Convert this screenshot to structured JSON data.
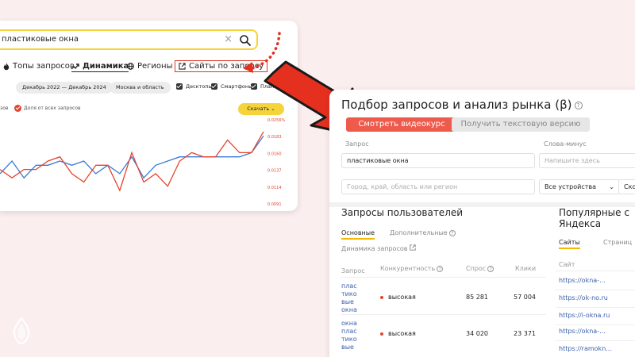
{
  "left": {
    "search_value": "пластиковые окна",
    "tabs": [
      {
        "label": "Топы запросов"
      },
      {
        "label": "Динамика"
      },
      {
        "label": "Регионы"
      },
      {
        "label": "Сайты по запросу"
      }
    ],
    "filters": {
      "period": "Декабрь 2022 — Декабрь 2024",
      "region": "Москва и область",
      "desktop": "Десктопы",
      "smartphones": "Смартфоны",
      "tablets": "Планш"
    },
    "legend": {
      "blue": "зов",
      "red": "Доля от всех запросов"
    },
    "download": "Скачать",
    "y_ticks": [
      "0.0256%",
      "0.0183",
      "0.0160",
      "0.0137",
      "0.0114",
      "0.0091"
    ]
  },
  "chart_data": {
    "type": "line",
    "ylabels_right": [
      "0.0256%",
      "0.0183",
      "0.0160",
      "0.0137",
      "0.0114",
      "0.0091"
    ],
    "series": [
      {
        "color": "#3a7bd5",
        "values": [
          0.35,
          0.5,
          0.3,
          0.45,
          0.45,
          0.5,
          0.45,
          0.5,
          0.35,
          0.45,
          0.35,
          0.55,
          0.3,
          0.45,
          0.5,
          0.55,
          0.55,
          0.55,
          0.55,
          0.55,
          0.55,
          0.6,
          0.8
        ]
      },
      {
        "color": "#e5442d",
        "values": [
          0.4,
          0.3,
          0.4,
          0.4,
          0.5,
          0.55,
          0.35,
          0.25,
          0.45,
          0.45,
          0.15,
          0.6,
          0.25,
          0.35,
          0.2,
          0.5,
          0.6,
          0.55,
          0.55,
          0.75,
          0.6,
          0.6,
          0.85
        ]
      }
    ]
  },
  "right": {
    "title": "Подбор запросов и анализ рынка (β)",
    "btn_video": "Смотреть видеокурс",
    "btn_text": "Получить текстовую версию",
    "label_query": "Запрос",
    "label_minus": "Слова-минус",
    "query_value": "пластиковые окна",
    "minus_placeholder": "Напишите здесь",
    "region_placeholder": "Город, край, область или регион",
    "devices": "Все устройства",
    "extra": "Ско",
    "users_title": "Запросы пользователей",
    "tab_main": "Основные",
    "tab_extra": "Дополнительные",
    "dyn_link": "Динамика запросов",
    "col_query": "Запрос",
    "col_comp": "Конкурентность",
    "col_demand": "Спрос",
    "col_clicks": "Клики",
    "rows": [
      {
        "q": [
          "плас",
          "тико",
          "вые",
          "окна"
        ],
        "comp": "высокая",
        "demand": "85 281",
        "clicks": "57 004"
      },
      {
        "q": [
          "окна",
          "плас",
          "тико",
          "вые"
        ],
        "comp": "высокая",
        "demand": "34 020",
        "clicks": "23 371"
      }
    ],
    "popular_title": [
      "Популярные с",
      "Яндекса"
    ],
    "tab_sites": "Сайты",
    "tab_pages": "Страниц",
    "col_site": "Сайт",
    "sites": [
      "https://okna-...",
      "https://ok-no.ru",
      "https://i-okna.ru",
      "https://okna-...",
      "https://ramokn..."
    ]
  }
}
